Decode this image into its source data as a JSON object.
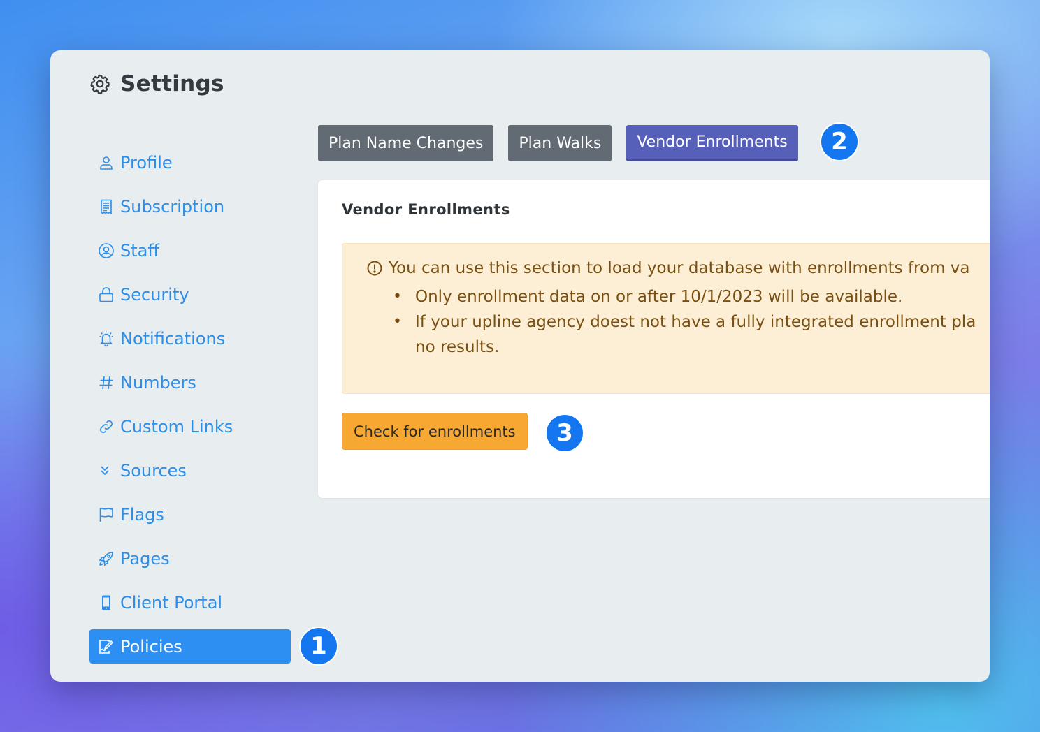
{
  "title": "Settings",
  "sidebar": {
    "items": [
      {
        "label": "Profile",
        "icon": "person-icon"
      },
      {
        "label": "Subscription",
        "icon": "receipt-icon"
      },
      {
        "label": "Staff",
        "icon": "person-circle-icon"
      },
      {
        "label": "Security",
        "icon": "lock-icon"
      },
      {
        "label": "Notifications",
        "icon": "bell-icon"
      },
      {
        "label": "Numbers",
        "icon": "hash-icon"
      },
      {
        "label": "Custom Links",
        "icon": "link-icon"
      },
      {
        "label": "Sources",
        "icon": "chevrons-down-icon"
      },
      {
        "label": "Flags",
        "icon": "flag-icon"
      },
      {
        "label": "Pages",
        "icon": "rocket-icon"
      },
      {
        "label": "Client Portal",
        "icon": "phone-icon"
      },
      {
        "label": "Policies",
        "icon": "file-signature-icon",
        "active": true
      }
    ]
  },
  "tabs": [
    {
      "label": "Plan Name Changes"
    },
    {
      "label": "Plan Walks"
    },
    {
      "label": "Vendor Enrollments",
      "active": true
    }
  ],
  "card": {
    "title": "Vendor Enrollments",
    "alert": {
      "intro": "You can use this section to load your database with enrollments from va",
      "bullets": [
        "Only enrollment data on or after 10/1/2023 will be available.",
        "If your upline agency doest not have a fully integrated enrollment pla",
        "no results."
      ]
    },
    "button_label": "Check for enrollments"
  },
  "markers": [
    "1",
    "2",
    "3"
  ],
  "colors": {
    "accent": "#2e8ff2",
    "tab_default": "#626b74",
    "tab_active": "#5660b8",
    "alert_bg": "#fdefd6",
    "alert_text": "#7a5012",
    "cta": "#f7a833",
    "marker": "#1477f0"
  }
}
